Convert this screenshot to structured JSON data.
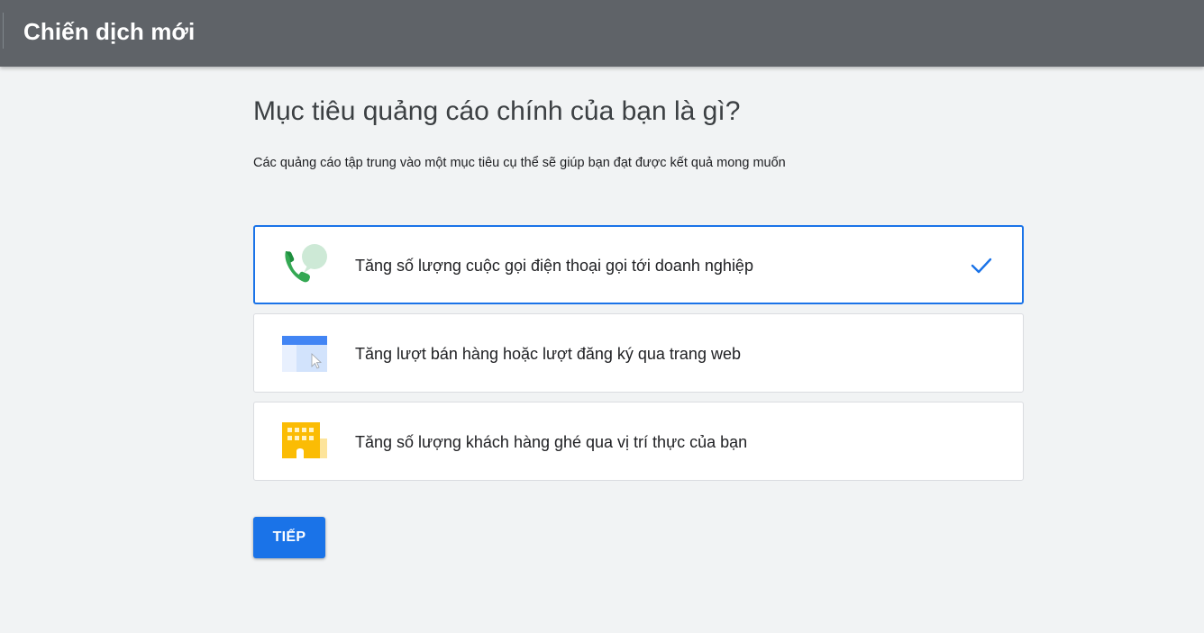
{
  "header": {
    "title": "Chiến dịch mới"
  },
  "main": {
    "heading": "Mục tiêu quảng cáo chính của bạn là gì?",
    "subheading": "Các quảng cáo tập trung vào một mục tiêu cụ thể sẽ giúp bạn đạt được kết quả mong muốn",
    "goals": [
      {
        "label": "Tăng số lượng cuộc gọi điện thoại gọi tới doanh nghiệp",
        "icon": "phone-call-icon",
        "selected": true
      },
      {
        "label": "Tăng lượt bán hàng hoặc lượt đăng ký qua trang web",
        "icon": "website-click-icon",
        "selected": false
      },
      {
        "label": "Tăng số lượng khách hàng ghé qua vị trí thực của bạn",
        "icon": "storefront-building-icon",
        "selected": false
      }
    ],
    "next_label": "TIẾP"
  },
  "colors": {
    "header_bg": "#5f6368",
    "page_bg": "#f1f3f4",
    "accent": "#1a73e8",
    "phone_green": "#34a853",
    "building_yellow": "#fbbc04"
  }
}
